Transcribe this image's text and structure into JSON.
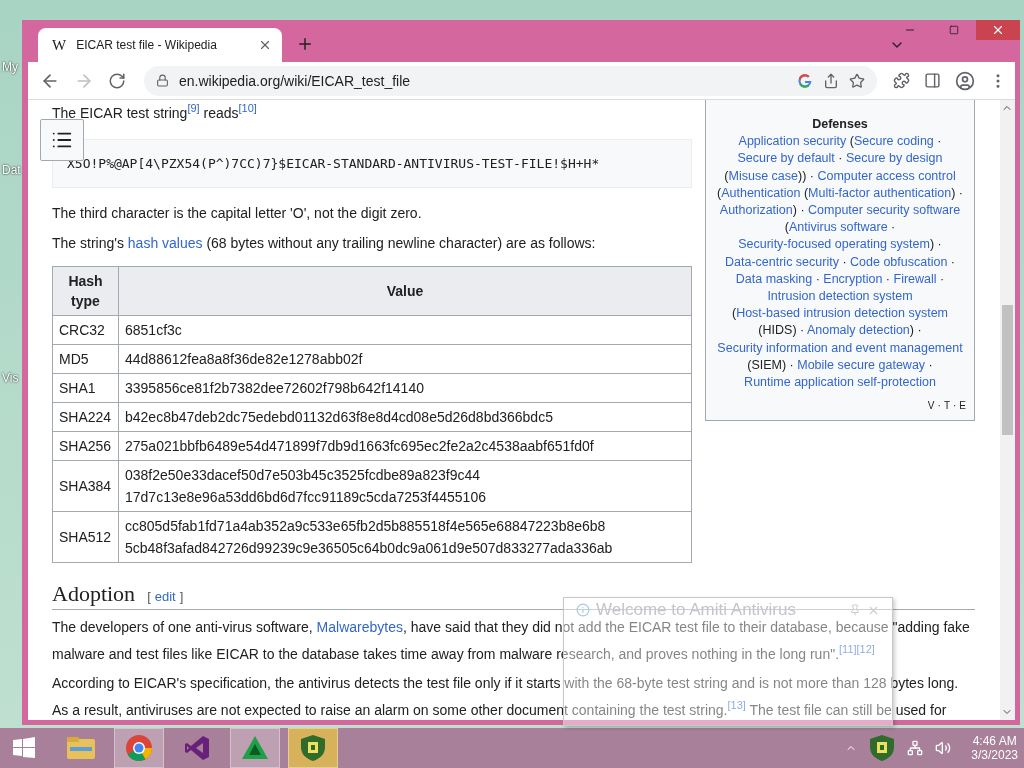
{
  "desktop": {
    "labels": [
      "My",
      "Dat",
      "Vis"
    ]
  },
  "browser": {
    "tab": {
      "favicon": "W",
      "title": "EICAR test file - Wikipedia",
      "selected": true
    },
    "back_enabled": true,
    "forward_enabled": false,
    "url": "en.wikipedia.org/wiki/EICAR_test_file"
  },
  "article": {
    "intro": [
      {
        "kind": "text",
        "text": "The EICAR test string"
      },
      {
        "kind": "ref",
        "text": "[9]"
      },
      {
        "kind": "text",
        "text": " reads"
      },
      {
        "kind": "ref",
        "text": "[10]"
      }
    ],
    "test_string": "X5O!P%@AP[4\\PZX54(P^)7CC)7}$EICAR-STANDARD-ANTIVIRUS-TEST-FILE!$H+H*",
    "paragraphs": [
      [
        {
          "kind": "text",
          "text": "The third character is the capital letter 'O', not the digit zero."
        }
      ],
      [
        {
          "kind": "text",
          "text": "The string's "
        },
        {
          "kind": "link",
          "text": "hash values"
        },
        {
          "kind": "text",
          "text": " (68 bytes without any trailing newline character) are as follows:"
        }
      ]
    ],
    "table": {
      "columns": [
        "Hash type",
        "Value"
      ],
      "rows": [
        {
          "type": "CRC32",
          "value": [
            "6851cf3c"
          ]
        },
        {
          "type": "MD5",
          "value": [
            "44d88612fea8a8f36de82e1278abb02f"
          ]
        },
        {
          "type": "SHA1",
          "value": [
            "3395856ce81f2b7382dee72602f798b642f14140"
          ]
        },
        {
          "type": "SHA224",
          "value": [
            "b42ec8b47deb2dc75edebd01132d63f8e8d4cd08e5d26d8bd366bdc5"
          ]
        },
        {
          "type": "SHA256",
          "value": [
            "275a021bbfb6489e54d471899f7db9d1663fc695ec2fe2a2c4538aabf651fd0f"
          ]
        },
        {
          "type": "SHA384",
          "value": [
            "038f2e50e33dacef50d7e503b45c3525fcdbe89a823f9c44",
            "17d7c13e8e96a53dd6bd6d7fcc91189c5cda7253f4455106"
          ]
        },
        {
          "type": "SHA512",
          "value": [
            "cc805d5fab1fd71a4ab352a9c533e65fb2d5b885518f4e565e68847223b8e6b8",
            "5cb48f3afad842726d99239c9e36505c64b0dc9a061d9e507d833277ada336ab"
          ]
        }
      ]
    },
    "infobox": {
      "heading": "Defenses",
      "segments": [
        {
          "kind": "link",
          "text": "Application security"
        },
        {
          "kind": "text",
          "text": " ("
        },
        {
          "kind": "link",
          "text": "Secure coding"
        },
        {
          "kind": "text",
          "text": " · "
        },
        {
          "kind": "link",
          "text": "Secure by default"
        },
        {
          "kind": "text",
          "text": " · "
        },
        {
          "kind": "link",
          "text": "Secure by design"
        },
        {
          "kind": "text",
          "text": " ("
        },
        {
          "kind": "link",
          "text": "Misuse case"
        },
        {
          "kind": "text",
          "text": ")) · "
        },
        {
          "kind": "link",
          "text": "Computer access control"
        },
        {
          "kind": "text",
          "text": " ("
        },
        {
          "kind": "link",
          "text": "Authentication"
        },
        {
          "kind": "text",
          "text": " ("
        },
        {
          "kind": "link",
          "text": "Multi-factor authentication"
        },
        {
          "kind": "text",
          "text": ") · "
        },
        {
          "kind": "link",
          "text": "Authorization"
        },
        {
          "kind": "text",
          "text": ") · "
        },
        {
          "kind": "link",
          "text": "Computer security software"
        },
        {
          "kind": "text",
          "text": " ("
        },
        {
          "kind": "link",
          "text": "Antivirus software"
        },
        {
          "kind": "text",
          "text": " · "
        },
        {
          "kind": "link",
          "text": "Security-focused operating system"
        },
        {
          "kind": "text",
          "text": ") · "
        },
        {
          "kind": "link",
          "text": "Data-centric security"
        },
        {
          "kind": "text",
          "text": " · "
        },
        {
          "kind": "link",
          "text": "Code obfuscation"
        },
        {
          "kind": "text",
          "text": " · "
        },
        {
          "kind": "link",
          "text": "Data masking"
        },
        {
          "kind": "text",
          "text": " · "
        },
        {
          "kind": "link",
          "text": "Encryption"
        },
        {
          "kind": "text",
          "text": " · "
        },
        {
          "kind": "link",
          "text": "Firewall"
        },
        {
          "kind": "text",
          "text": " · "
        },
        {
          "kind": "link",
          "text": "Intrusion detection system"
        },
        {
          "kind": "text",
          "text": " ("
        },
        {
          "kind": "link",
          "text": "Host-based intrusion detection system"
        },
        {
          "kind": "text",
          "text": " (HIDS) · "
        },
        {
          "kind": "link",
          "text": "Anomaly detection"
        },
        {
          "kind": "text",
          "text": ") · "
        },
        {
          "kind": "link",
          "text": "Security information and event management"
        },
        {
          "kind": "text",
          "text": " (SIEM) · "
        },
        {
          "kind": "link",
          "text": "Mobile secure gateway"
        },
        {
          "kind": "text",
          "text": " · "
        },
        {
          "kind": "link",
          "text": "Runtime application self-protection"
        }
      ],
      "navbox_links": [
        "V",
        "T",
        "E"
      ],
      "navbox_separator": "·"
    },
    "section": {
      "heading": "Adoption",
      "edit_link": "edit",
      "edit_brackets": [
        "[",
        "]"
      ],
      "paragraphs": [
        [
          {
            "kind": "text",
            "text": "The developers of one anti-virus software, "
          },
          {
            "kind": "link",
            "text": "Malwarebytes"
          },
          {
            "kind": "text",
            "text": ", have said that they did not add the EICAR test file to their database, because \"adding fake malware and test files like EICAR to the database takes time away from malware research, and proves nothing in the long run\"."
          },
          {
            "kind": "ref",
            "text": "[11][12]"
          }
        ],
        [
          {
            "kind": "text",
            "text": "According to EICAR's specification, the antivirus detects the test file only if it starts with the 68-byte test string and is not more than 128 bytes long. As a result, antiviruses are not expected to raise an alarm on some other document containing the test string."
          },
          {
            "kind": "ref",
            "text": "[13]"
          },
          {
            "kind": "text",
            "text": " The test file can still be used for"
          }
        ]
      ]
    }
  },
  "notification": {
    "title": "Welcome to Amiti Antivirus"
  },
  "taskbar": {
    "apps": [
      {
        "kind": "explorer",
        "running": false
      },
      {
        "kind": "chrome",
        "running": true
      },
      {
        "kind": "studio",
        "running": false
      },
      {
        "kind": "triangle",
        "running": true
      },
      {
        "kind": "shield",
        "running": true
      }
    ],
    "time": "4:46 AM",
    "date": "3/3/2023"
  }
}
